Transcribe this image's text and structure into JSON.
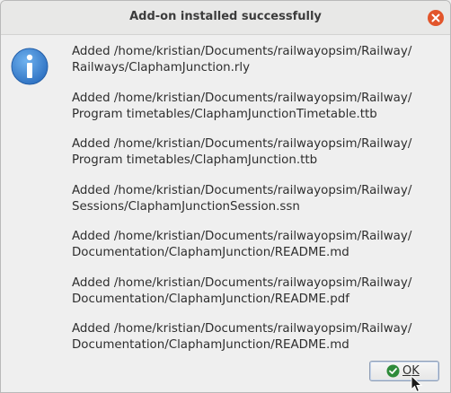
{
  "dialog": {
    "title": "Add-on installed successfully",
    "icon": "info-icon",
    "messages": [
      "Added /home/kristian/Documents/railwayopsim/Railway/\nRailways/ClaphamJunction.rly",
      "Added /home/kristian/Documents/railwayopsim/Railway/\nProgram timetables/ClaphamJunctionTimetable.ttb",
      "Added /home/kristian/Documents/railwayopsim/Railway/\nProgram timetables/ClaphamJunction.ttb",
      "Added /home/kristian/Documents/railwayopsim/Railway/\nSessions/ClaphamJunctionSession.ssn",
      "Added /home/kristian/Documents/railwayopsim/Railway/\nDocumentation/ClaphamJunction/README.md",
      "Added /home/kristian/Documents/railwayopsim/Railway/\nDocumentation/ClaphamJunction/README.pdf",
      "Added /home/kristian/Documents/railwayopsim/Railway/\nDocumentation/ClaphamJunction/README.md"
    ],
    "ok_label": "OK",
    "ok_icon": "check-circle-icon",
    "close_icon": "close-icon"
  },
  "colors": {
    "close_button": "#e2552b",
    "info_icon": "#3b7fcf",
    "ok_check": "#2e8b3a",
    "background": "#efefef"
  }
}
